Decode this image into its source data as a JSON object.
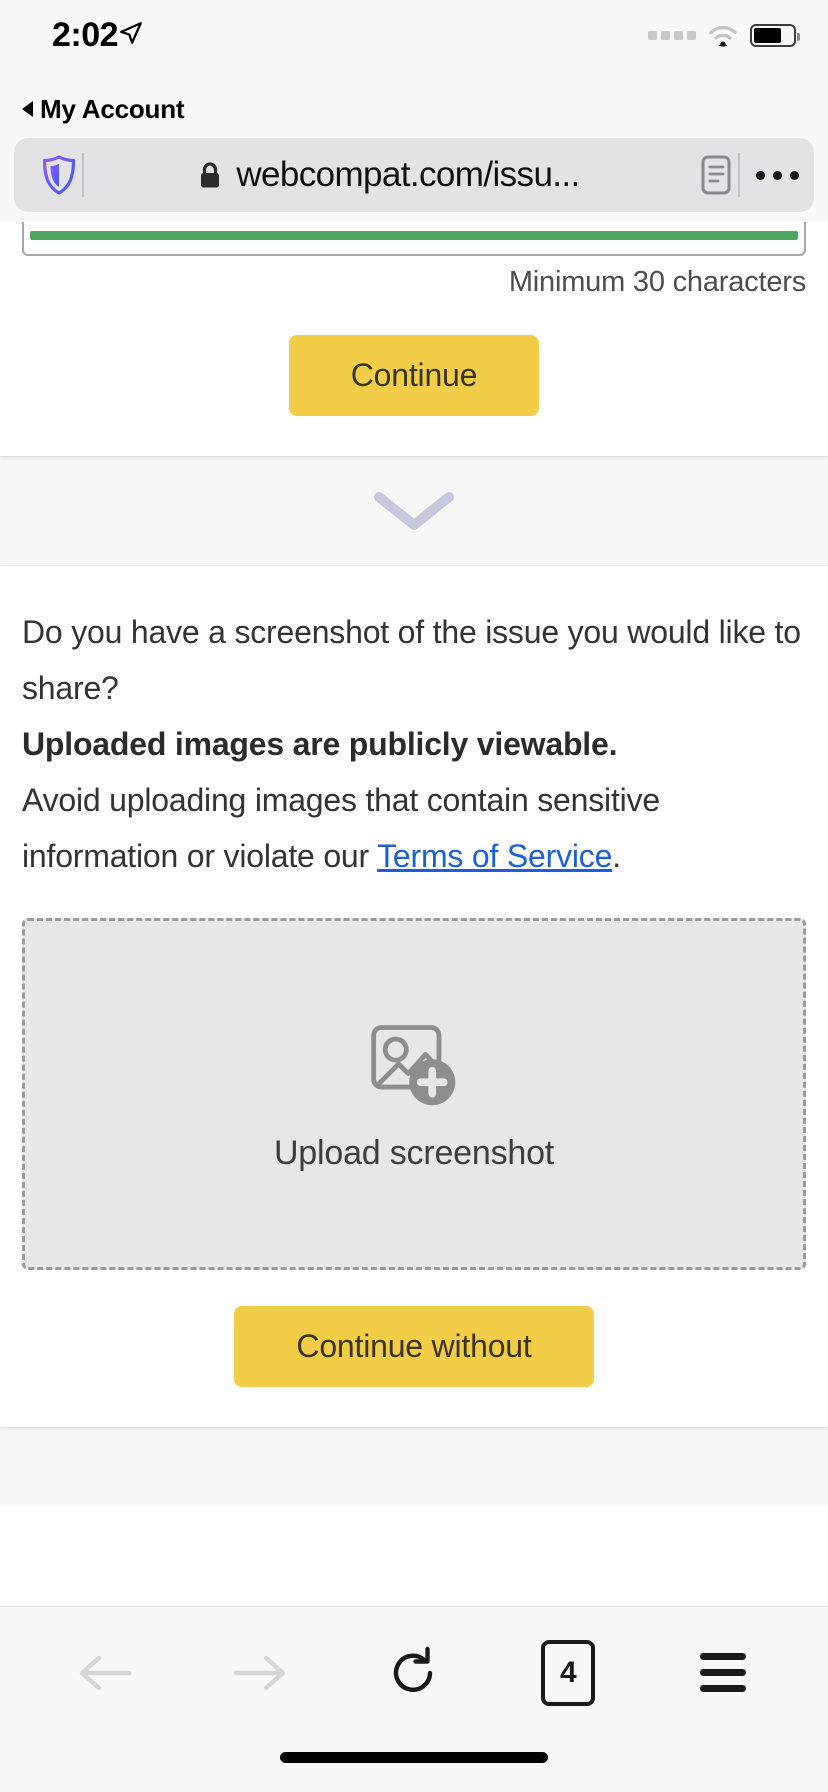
{
  "status_bar": {
    "time": "2:02",
    "location_icon": "location-arrow-icon",
    "signal_icon": "cellular-signal-icon",
    "wifi_icon": "wifi-icon",
    "battery_icon": "battery-icon"
  },
  "back_to_app": {
    "label": "My Account",
    "icon": "back-triangle-icon"
  },
  "browser": {
    "shield_icon": "shield-icon",
    "lock_icon": "lock-icon",
    "url": "webcompat.com/issu...",
    "reader_icon": "reader-mode-icon",
    "more_icon": "more-dots-icon"
  },
  "page": {
    "description_field": {
      "min_chars_hint": "Minimum 30 characters",
      "border_color": "#a8a8a8",
      "fill_color": "#4fa663"
    },
    "continue_button": {
      "label": "Continue",
      "bg": "#f2ce48",
      "fg": "#3b3423"
    },
    "separator": {
      "icon": "chevron-down-icon",
      "color": "#c8c8d8"
    },
    "screenshot_step": {
      "question_line_1": "Do you have a screenshot of the issue you",
      "question_line_2": "would like to share?",
      "warning": "Uploaded images are publicly viewable.",
      "advice_prefix": "Avoid uploading images that contain sensitive information or violate our ",
      "terms_link": "Terms of Service",
      "advice_suffix": ".",
      "link_color": "#1b5fd9",
      "dropzone": {
        "icon": "add-image-icon",
        "label": "Upload screenshot",
        "bg": "#e7e7e7",
        "border": "#9b9b9b"
      },
      "continue_without_button": {
        "label": "Continue without",
        "bg": "#f2ce48",
        "fg": "#3b3423"
      }
    }
  },
  "toolbar": {
    "back_icon": "back-arrow-icon",
    "forward_icon": "forward-arrow-icon",
    "reload_icon": "reload-icon",
    "tab_count": "4",
    "menu_icon": "hamburger-menu-icon"
  },
  "home_indicator": "home-indicator-bar"
}
